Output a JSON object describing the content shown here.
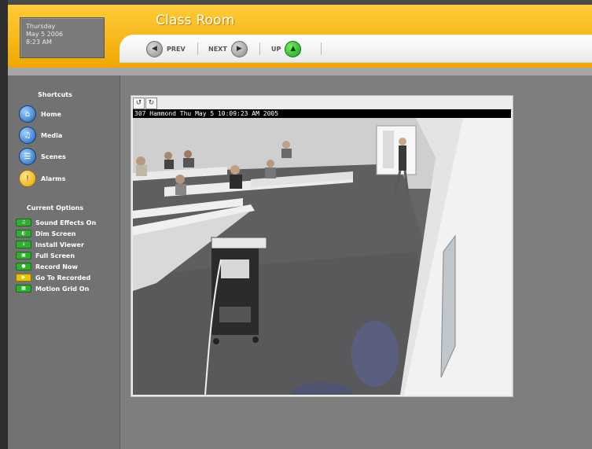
{
  "header": {
    "date": {
      "day": "Thursday",
      "date": "May 5 2006",
      "time": "8:23 AM"
    },
    "title": "Class Room"
  },
  "nav": {
    "prev_label": "PREV",
    "next_label": "NEXT",
    "up_label": "UP"
  },
  "sidebar": {
    "shortcuts_heading": "Shortcuts",
    "shortcuts": [
      {
        "label": "Home",
        "icon": "home-icon"
      },
      {
        "label": "Media",
        "icon": "speaker-icon"
      },
      {
        "label": "Scenes",
        "icon": "scenes-icon"
      },
      {
        "label": "Alarms",
        "icon": "alarm-icon"
      }
    ],
    "options_heading": "Current Options",
    "options": [
      {
        "label": "Sound Effects On",
        "icon": "speaker-icon"
      },
      {
        "label": "Dim Screen",
        "icon": "dim-icon"
      },
      {
        "label": "Install Viewer",
        "icon": "install-icon"
      },
      {
        "label": "Full Screen",
        "icon": "fullscreen-icon"
      },
      {
        "label": "Record Now",
        "icon": "record-icon"
      },
      {
        "label": "Go To Recorded",
        "icon": "folder-icon"
      },
      {
        "label": "Motion Grid On",
        "icon": "grid-icon"
      }
    ]
  },
  "camera": {
    "caption": "307 Hammond   Thu May  5  10:09:23 AM  2005"
  },
  "colors": {
    "header_accent": "#f5b400",
    "nav_up_green": "#2fbf2f",
    "shortcut_blue": "#1a5fb5",
    "option_green": "#2fae2f"
  }
}
